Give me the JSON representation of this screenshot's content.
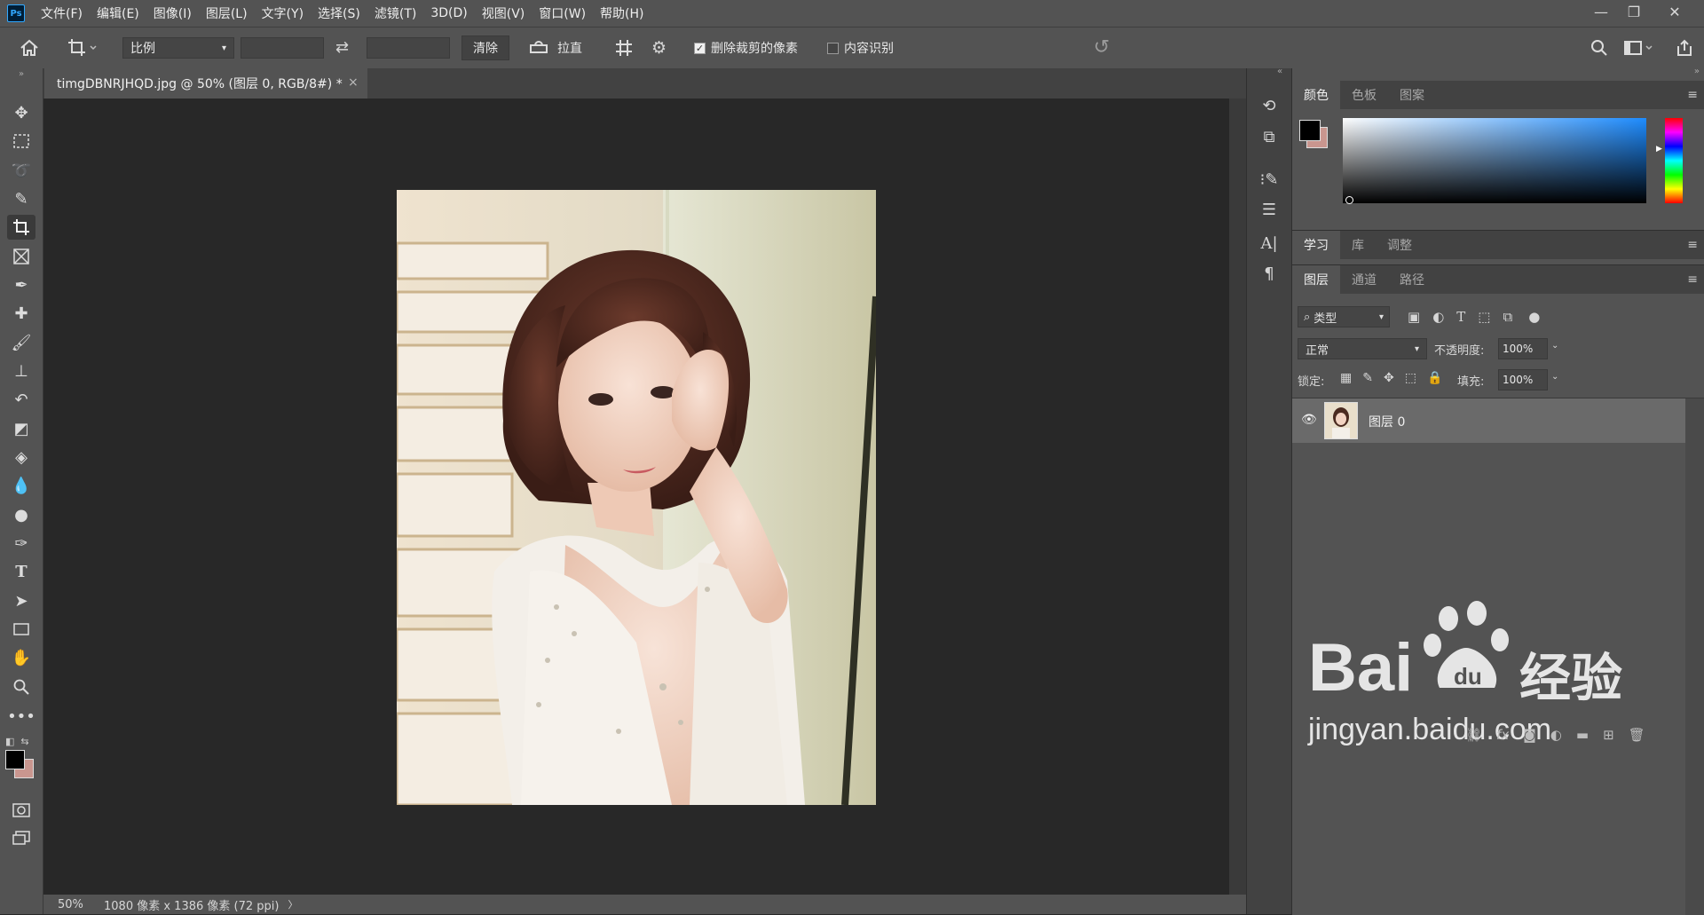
{
  "menubar": {
    "logo": "Ps",
    "items": [
      "文件(F)",
      "编辑(E)",
      "图像(I)",
      "图层(L)",
      "文字(Y)",
      "选择(S)",
      "滤镜(T)",
      "3D(D)",
      "视图(V)",
      "窗口(W)",
      "帮助(H)"
    ],
    "minimize": "—",
    "restore": "❐",
    "close": "✕"
  },
  "options": {
    "ratio_select": "比例",
    "ratio_width": "",
    "ratio_height": "",
    "clear_button": "清除",
    "straighten_label": "拉直",
    "delete_cropped_label": "删除裁剪的像素",
    "delete_cropped_checked": true,
    "content_aware_label": "内容识别",
    "content_aware_checked": false
  },
  "document": {
    "tab_title": "timgDBNRJHQD.jpg @ 50% (图层 0, RGB/8#) *",
    "close": "×"
  },
  "status": {
    "zoom": "50%",
    "doc_info": "1080 像素 x 1386 像素 (72 ppi)",
    "arrow": "〉"
  },
  "panels": {
    "color_tabs": [
      "颜色",
      "色板",
      "图案"
    ],
    "learn_tabs": [
      "学习",
      "库",
      "调整"
    ],
    "layer_tabs": [
      "图层",
      "通道",
      "路径"
    ],
    "filter_kind": "类型",
    "blend_mode": "正常",
    "opacity_label": "不透明度:",
    "opacity_value": "100%",
    "lock_label": "锁定:",
    "fill_label": "填充:",
    "fill_value": "100%",
    "layers": [
      {
        "name": "图层 0",
        "visible": true
      }
    ]
  },
  "watermark": {
    "brand": "Bai",
    "brand2": "经验",
    "url": "jingyan.baidu.com"
  },
  "colors": {
    "foreground": "#000000",
    "background": "#c9968f",
    "accent": "#31a8ff"
  }
}
